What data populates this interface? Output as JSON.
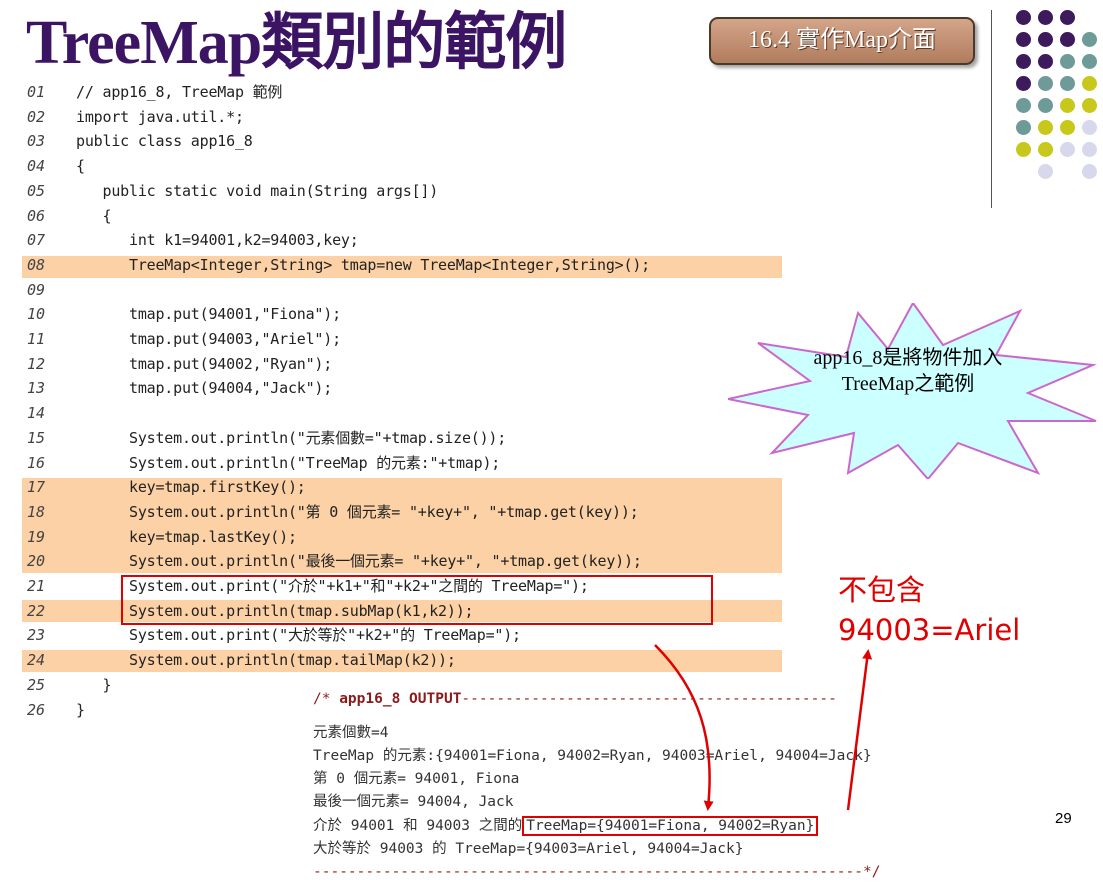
{
  "title": "TreeMap類別的範例",
  "section_button": "16.4 實作Map介面",
  "dots": {
    "colors": {
      "purple": "#3d1a5b",
      "teal": "#6e9a98",
      "lime": "#c8c81c",
      "lavender": "#d8d8ec"
    }
  },
  "code_lines": [
    {
      "no": "01",
      "text": "// app16_8, TreeMap 範例"
    },
    {
      "no": "02",
      "text": "import java.util.*;"
    },
    {
      "no": "03",
      "text": "public class app16_8"
    },
    {
      "no": "04",
      "text": "{"
    },
    {
      "no": "05",
      "text": "   public static void main(String args[])"
    },
    {
      "no": "06",
      "text": "   {"
    },
    {
      "no": "07",
      "text": "      int k1=94001,k2=94003,key;"
    },
    {
      "no": "08",
      "text": "      TreeMap<Integer,String> tmap=new TreeMap<Integer,String>();"
    },
    {
      "no": "09",
      "text": ""
    },
    {
      "no": "10",
      "text": "      tmap.put(94001,\"Fiona\");"
    },
    {
      "no": "11",
      "text": "      tmap.put(94003,\"Ariel\");"
    },
    {
      "no": "12",
      "text": "      tmap.put(94002,\"Ryan\");"
    },
    {
      "no": "13",
      "text": "      tmap.put(94004,\"Jack\");"
    },
    {
      "no": "14",
      "text": ""
    },
    {
      "no": "15",
      "text": "      System.out.println(\"元素個數=\"+tmap.size());"
    },
    {
      "no": "16",
      "text": "      System.out.println(\"TreeMap 的元素:\"+tmap);"
    },
    {
      "no": "17",
      "text": "      key=tmap.firstKey();"
    },
    {
      "no": "18",
      "text": "      System.out.println(\"第 0 個元素= \"+key+\", \"+tmap.get(key));"
    },
    {
      "no": "19",
      "text": "      key=tmap.lastKey();"
    },
    {
      "no": "20",
      "text": "      System.out.println(\"最後一個元素= \"+key+\", \"+tmap.get(key));"
    },
    {
      "no": "21",
      "text": "      System.out.print(\"介於\"+k1+\"和\"+k2+\"之間的 TreeMap=\");"
    },
    {
      "no": "22",
      "text": "      System.out.println(tmap.subMap(k1,k2));"
    },
    {
      "no": "23",
      "text": "      System.out.print(\"大於等於\"+k2+\"的 TreeMap=\");"
    },
    {
      "no": "24",
      "text": "      System.out.println(tmap.tailMap(k2));"
    },
    {
      "no": "25",
      "text": "   }"
    },
    {
      "no": "26",
      "text": "}"
    }
  ],
  "callout": "app16_8是將物件加入TreeMap之範例",
  "note": {
    "line1": "不包含",
    "line2": "94003=Ariel"
  },
  "output": {
    "header_prefix": "/* ",
    "header_name": "app16_8 OUTPUT",
    "header_dashes": "-------------------------------------------",
    "lines": [
      "元素個數=4",
      "TreeMap 的元素:{94001=Fiona, 94002=Ryan, 94003=Ariel, 94004=Jack}",
      "第 0 個元素= 94001, Fiona",
      "最後一個元素= 94004, Jack"
    ],
    "submap_prefix": "介於 94001 和 94003 之間的",
    "submap_value": "TreeMap={94001=Fiona, 94002=Ryan}",
    "tailmap_line": "大於等於 94003 的 TreeMap={94003=Ariel, 94004=Jack}",
    "footer": "---------------------------------------------------------------*/"
  },
  "page_number": "29",
  "colors": {
    "title": "#3b1464",
    "highlight": "#fcd1a5",
    "red": "#e00000",
    "callout_fill": "#ccffff"
  }
}
